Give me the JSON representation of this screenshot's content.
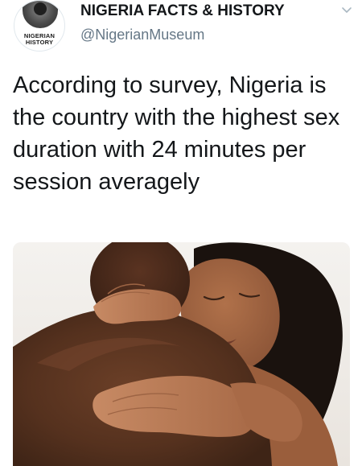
{
  "account": {
    "name": "NIGERIA FACTS & HISTORY",
    "handle": "@NigerianMuseum",
    "avatar_text_line1": "NIGERIAN",
    "avatar_text_line2": "HISTORY"
  },
  "tweet": {
    "text": "According to survey, Nigeria is the country with the highest sex duration with 24 minutes per session averagely"
  },
  "icons": {
    "menu": "chevron-down-icon"
  },
  "colors": {
    "name": "#14171a",
    "handle": "#657786",
    "chevron": "#aab8c2"
  }
}
